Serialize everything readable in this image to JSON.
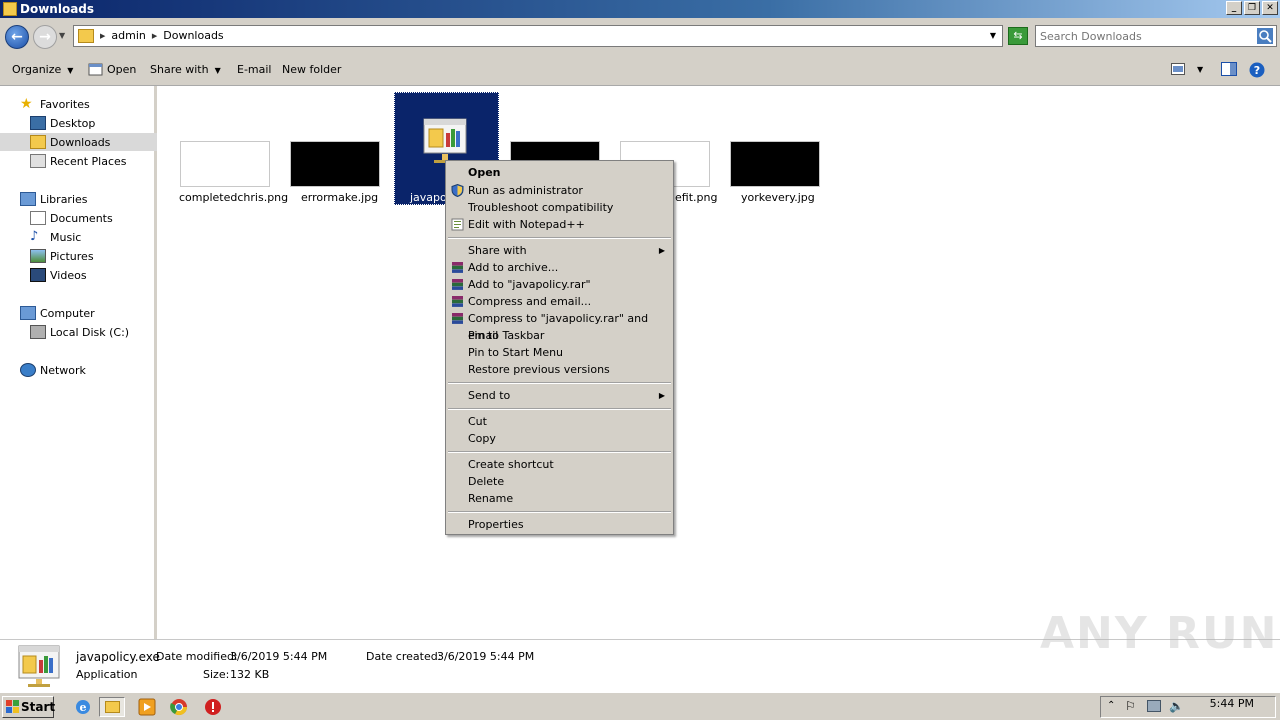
{
  "window": {
    "title": "Downloads"
  },
  "address": {
    "crumbs": [
      "admin",
      "Downloads"
    ]
  },
  "search": {
    "placeholder": "Search Downloads"
  },
  "toolbar": {
    "organize": "Organize",
    "open": "Open",
    "share_with": "Share with",
    "email": "E-mail",
    "new_folder": "New folder"
  },
  "nav": {
    "favorites": "Favorites",
    "desktop": "Desktop",
    "downloads": "Downloads",
    "recent_places": "Recent Places",
    "libraries": "Libraries",
    "documents": "Documents",
    "music": "Music",
    "pictures": "Pictures",
    "videos": "Videos",
    "computer": "Computer",
    "local_disk": "Local Disk (C:)",
    "network": "Network"
  },
  "files": [
    {
      "name": "completedchris.png"
    },
    {
      "name": "errormake.jpg"
    },
    {
      "name": "javapol"
    },
    {
      "name": ""
    },
    {
      "name": "efit.png"
    },
    {
      "name": "yorkevery.jpg"
    }
  ],
  "context_menu": {
    "open": "Open",
    "run_as_admin": "Run as administrator",
    "troubleshoot": "Troubleshoot compatibility",
    "edit_notepad": "Edit with Notepad++",
    "share_with": "Share with",
    "add_archive": "Add to archive...",
    "add_rar": "Add to \"javapolicy.rar\"",
    "compress_email": "Compress and email...",
    "compress_rar_email": "Compress to \"javapolicy.rar\" and email",
    "pin_taskbar": "Pin to Taskbar",
    "pin_start": "Pin to Start Menu",
    "restore": "Restore previous versions",
    "send_to": "Send to",
    "cut": "Cut",
    "copy": "Copy",
    "create_shortcut": "Create shortcut",
    "delete": "Delete",
    "rename": "Rename",
    "properties": "Properties"
  },
  "details": {
    "filename": "javapolicy.exe",
    "type": "Application",
    "date_modified_label": "Date modified:",
    "date_modified": "3/6/2019 5:44 PM",
    "size_label": "Size:",
    "size": "132 KB",
    "date_created_label": "Date created:",
    "date_created": "3/6/2019 5:44 PM"
  },
  "taskbar": {
    "start": "Start",
    "clock": "5:44 PM"
  },
  "watermark": "ANY RUN"
}
